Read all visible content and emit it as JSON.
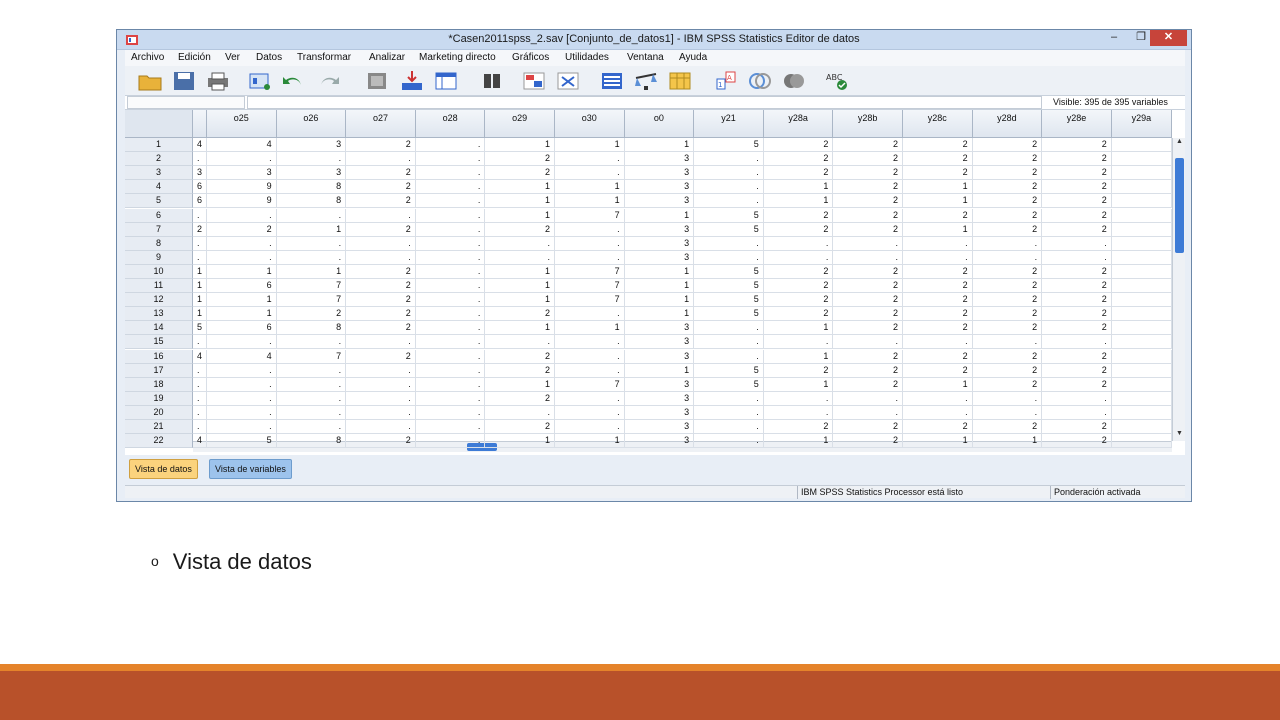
{
  "window": {
    "title": "*Casen2011spss_2.sav [Conjunto_de_datos1] - IBM SPSS Statistics Editor de datos",
    "minimize": "–",
    "maximize": "❐",
    "close": "✕"
  },
  "menu": [
    "Archivo",
    "Edición",
    "Ver",
    "Datos",
    "Transformar",
    "Analizar",
    "Marketing directo",
    "Gráficos",
    "Utilidades",
    "Ventana",
    "Ayuda"
  ],
  "toolbar_icons": [
    "open-icon",
    "save-icon",
    "print-icon",
    "recall-dialog-icon",
    "undo-icon",
    "redo-icon",
    "goto-case-icon",
    "goto-variable-icon",
    "variables-icon",
    "find-icon",
    "insert-cases-icon",
    "insert-variable-icon",
    "split-file-icon",
    "weight-cases-icon",
    "select-cases-icon",
    "value-labels-icon",
    "use-variable-sets-icon",
    "show-all-variables-icon",
    "spell-check-icon"
  ],
  "cellbar": {
    "visible": "Visible: 395 de 395 variables"
  },
  "grid": {
    "columns": [
      "",
      "o25",
      "o26",
      "o27",
      "o28",
      "o29",
      "o30",
      "o0",
      "y21",
      "y28a",
      "y28b",
      "y28c",
      "y28d",
      "y28e",
      "y29a"
    ],
    "rows": [
      [
        "4",
        "4",
        "3",
        "2",
        ".",
        "1",
        "1",
        "1",
        "5",
        "2",
        "2",
        "2",
        "2",
        "2",
        ""
      ],
      [
        ".",
        ".",
        ".",
        ".",
        ".",
        "2",
        ".",
        "3",
        ".",
        "2",
        "2",
        "2",
        "2",
        "2",
        ""
      ],
      [
        "3",
        "3",
        "3",
        "2",
        ".",
        "2",
        ".",
        "3",
        ".",
        "2",
        "2",
        "2",
        "2",
        "2",
        ""
      ],
      [
        "6",
        "9",
        "8",
        "2",
        ".",
        "1",
        "1",
        "3",
        ".",
        "1",
        "2",
        "1",
        "2",
        "2",
        ""
      ],
      [
        "6",
        "9",
        "8",
        "2",
        ".",
        "1",
        "1",
        "3",
        ".",
        "1",
        "2",
        "1",
        "2",
        "2",
        ""
      ],
      [
        ".",
        ".",
        ".",
        ".",
        ".",
        "1",
        "7",
        "1",
        "5",
        "2",
        "2",
        "2",
        "2",
        "2",
        ""
      ],
      [
        "2",
        "2",
        "1",
        "2",
        ".",
        "2",
        ".",
        "3",
        "5",
        "2",
        "2",
        "1",
        "2",
        "2",
        ""
      ],
      [
        ".",
        ".",
        ".",
        ".",
        ".",
        ".",
        ".",
        "3",
        ".",
        ".",
        ".",
        ".",
        ".",
        ".",
        ""
      ],
      [
        ".",
        ".",
        ".",
        ".",
        ".",
        ".",
        ".",
        "3",
        ".",
        ".",
        ".",
        ".",
        ".",
        ".",
        ""
      ],
      [
        "1",
        "1",
        "1",
        "2",
        ".",
        "1",
        "7",
        "1",
        "5",
        "2",
        "2",
        "2",
        "2",
        "2",
        ""
      ],
      [
        "1",
        "6",
        "7",
        "2",
        ".",
        "1",
        "7",
        "1",
        "5",
        "2",
        "2",
        "2",
        "2",
        "2",
        ""
      ],
      [
        "1",
        "1",
        "7",
        "2",
        ".",
        "1",
        "7",
        "1",
        "5",
        "2",
        "2",
        "2",
        "2",
        "2",
        ""
      ],
      [
        "1",
        "1",
        "2",
        "2",
        ".",
        "2",
        ".",
        "1",
        "5",
        "2",
        "2",
        "2",
        "2",
        "2",
        ""
      ],
      [
        "5",
        "6",
        "8",
        "2",
        ".",
        "1",
        "1",
        "3",
        ".",
        "1",
        "2",
        "2",
        "2",
        "2",
        ""
      ],
      [
        ".",
        ".",
        ".",
        ".",
        ".",
        ".",
        ".",
        "3",
        ".",
        ".",
        ".",
        ".",
        ".",
        ".",
        ""
      ],
      [
        "4",
        "4",
        "7",
        "2",
        ".",
        "2",
        ".",
        "3",
        ".",
        "1",
        "2",
        "2",
        "2",
        "2",
        ""
      ],
      [
        ".",
        ".",
        ".",
        ".",
        ".",
        "2",
        ".",
        "1",
        "5",
        "2",
        "2",
        "2",
        "2",
        "2",
        ""
      ],
      [
        ".",
        ".",
        ".",
        ".",
        ".",
        "1",
        "7",
        "3",
        "5",
        "1",
        "2",
        "1",
        "2",
        "2",
        ""
      ],
      [
        ".",
        ".",
        ".",
        ".",
        ".",
        "2",
        ".",
        "3",
        ".",
        ".",
        ".",
        ".",
        ".",
        ".",
        ""
      ],
      [
        ".",
        ".",
        ".",
        ".",
        ".",
        ".",
        ".",
        "3",
        ".",
        ".",
        ".",
        ".",
        ".",
        ".",
        ""
      ],
      [
        ".",
        ".",
        ".",
        ".",
        ".",
        "2",
        ".",
        "3",
        ".",
        "2",
        "2",
        "2",
        "2",
        "2",
        ""
      ],
      [
        "4",
        "5",
        "8",
        "2",
        ".",
        "1",
        "1",
        "3",
        ".",
        "1",
        "2",
        "1",
        "1",
        "2",
        ""
      ]
    ]
  },
  "tabs": {
    "data_view": "Vista de datos",
    "variable_view": "Vista de variables"
  },
  "status": {
    "processor": "IBM SPSS Statistics Processor está listo",
    "weight": "Ponderación activada"
  },
  "caption": {
    "bullet": "o",
    "text": "Vista de datos"
  },
  "colors": {
    "accent_orange": "#e5832a",
    "footer_rust": "#b8512a",
    "active_tab": "#fbd37d",
    "inactive_tab": "#9dc3ec",
    "scroll_thumb": "#3d7bd6"
  }
}
